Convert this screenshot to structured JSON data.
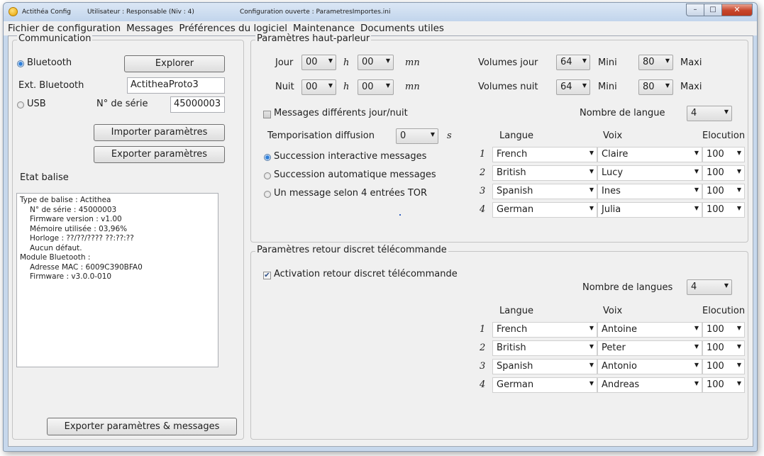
{
  "window": {
    "app_title": "Actithéa Config",
    "user": "Utilisateur : Responsable (Niv : 4)",
    "config": "Configuration ouverte : ParametresImportes.ini",
    "minimize_icon": "minimize-icon",
    "maximize_icon": "maximize-icon",
    "close_icon": "close-icon"
  },
  "menu": [
    "Fichier de configuration",
    "Messages",
    "Préférences du logiciel",
    "Maintenance",
    "Documents utiles"
  ],
  "communication": {
    "title": "Communication",
    "bluetooth_label": "Bluetooth",
    "explorer_button": "Explorer",
    "ext_bluetooth_label": "Ext. Bluetooth",
    "ext_bluetooth_value": "ActitheaProto3",
    "usb_label": "USB",
    "serial_label": "N° de série",
    "serial_value": "45000003",
    "import_button": "Importer paramètres",
    "export_button": "Exporter paramètres",
    "etat_label": "Etat balise",
    "status_lines": [
      "Type de balise : Actithea",
      "N° de série : 45000003",
      "Firmware version : v1.00",
      "Mémoire utilisée : 03,96%",
      "Horloge : ??/??/???? ??:??:??",
      "Aucun défaut.",
      "Module Bluetooth :",
      "Adresse MAC : 6009C390BFA0",
      "Firmware : v3.0.0-010"
    ],
    "export_all_button": "Exporter paramètres & messages"
  },
  "speaker": {
    "title": "Paramètres haut-parleur",
    "jour_label": "Jour",
    "nuit_label": "Nuit",
    "h_label": "h",
    "mn_label": "mn",
    "jour_h": "00",
    "jour_mn": "00",
    "nuit_h": "00",
    "nuit_mn": "00",
    "volumes_jour_label": "Volumes jour",
    "volumes_nuit_label": "Volumes nuit",
    "vol_jour": "64",
    "vol_nuit": "64",
    "mini_label": "Mini",
    "maxi_label": "Maxi",
    "maxi_jour": "80",
    "maxi_nuit": "80",
    "diff_messages_label": "Messages différents jour/nuit",
    "nombre_langue_label": "Nombre de langue",
    "nombre_langue_value": "4",
    "tempo_label": "Temporisation diffusion",
    "tempo_value": "0",
    "tempo_unit": "s",
    "radio_interactive": "Succession interactive messages",
    "radio_auto": "Succession automatique messages",
    "radio_tor": "Un message selon 4 entrées TOR",
    "col_langue": "Langue",
    "col_voix": "Voix",
    "col_elocution": "Elocution",
    "rows": [
      {
        "num": "1",
        "langue": "French",
        "voix": "Claire",
        "elocution": "100"
      },
      {
        "num": "2",
        "langue": "British",
        "voix": "Lucy",
        "elocution": "100"
      },
      {
        "num": "3",
        "langue": "Spanish",
        "voix": "Ines",
        "elocution": "100"
      },
      {
        "num": "4",
        "langue": "German",
        "voix": "Julia",
        "elocution": "100"
      }
    ]
  },
  "remote": {
    "title": "Paramètres retour discret télécommande",
    "activation_label": "Activation retour discret télécommande",
    "nombre_langues_label": "Nombre de langues",
    "nombre_langues_value": "4",
    "col_langue": "Langue",
    "col_voix": "Voix",
    "col_elocution": "Elocution",
    "rows": [
      {
        "num": "1",
        "langue": "French",
        "voix": "Antoine",
        "elocution": "100"
      },
      {
        "num": "2",
        "langue": "British",
        "voix": "Peter",
        "elocution": "100"
      },
      {
        "num": "3",
        "langue": "Spanish",
        "voix": "Antonio",
        "elocution": "100"
      },
      {
        "num": "4",
        "langue": "German",
        "voix": "Andreas",
        "elocution": "100"
      }
    ]
  },
  "colors": {
    "titlebar": "#c7d8ec",
    "client_bg": "#f0f0f0",
    "close_button": "#c7452a",
    "radio_selected": "#2f7fd9"
  }
}
